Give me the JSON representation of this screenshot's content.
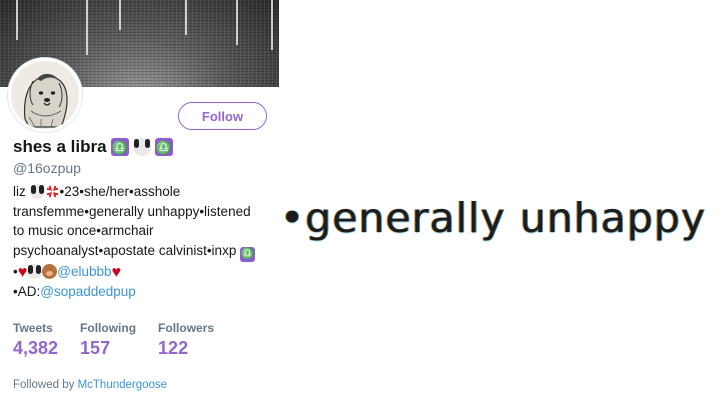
{
  "profile": {
    "name": "shes a libra",
    "handle": "@16ozpup",
    "follow_label": "Follow",
    "libra_glyph": "♎",
    "bio": {
      "line1_text": "liz",
      "line1_rest": "•23•she/her•asshole",
      "line2": "transfemme•generally unhappy•listened",
      "line3": "to music once•armchair",
      "line4": "psychoanalyst•apostate calvinist•inxp",
      "line5_prefix": "•",
      "mention1": "@elubbb",
      "line6_prefix": "•AD:",
      "mention2": "@sopaddedpup"
    },
    "stats": [
      {
        "label": "Tweets",
        "value": "4,382"
      },
      {
        "label": "Following",
        "value": "157"
      },
      {
        "label": "Followers",
        "value": "122"
      }
    ],
    "followed_by_prefix": "Followed by",
    "followed_by_user": "McThundergoose"
  },
  "zoom_caption": "•generally unhappy",
  "colors": {
    "accent": "#9266cc",
    "link": "#3b94d9",
    "muted": "#657786",
    "heart": "#d0021b",
    "libra_badge": "#8e5bd2"
  },
  "icons": [
    "libra-icon",
    "dog-icon",
    "anger-icon",
    "heart-icon",
    "bear-icon"
  ]
}
